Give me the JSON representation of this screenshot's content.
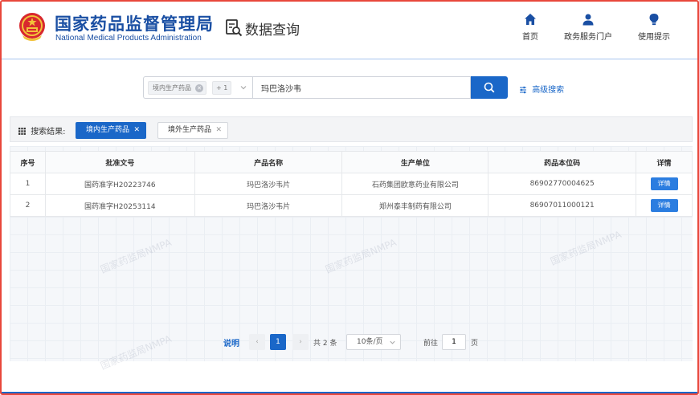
{
  "header": {
    "org_name_cn": "国家药品监督管理局",
    "org_name_en": "National Medical Products Administration",
    "page_title": "数据查询",
    "nav": [
      {
        "label": "首页",
        "icon": "home-icon"
      },
      {
        "label": "政务服务门户",
        "icon": "user-icon"
      },
      {
        "label": "使用提示",
        "icon": "bulb-icon"
      }
    ]
  },
  "search": {
    "category_tag": "境内生产药品",
    "more_count": "+ 1",
    "value": "玛巴洛沙韦",
    "advanced_label": "高级搜索"
  },
  "results": {
    "label": "搜索结果:",
    "tabs": [
      {
        "label": "境内生产药品",
        "active": true
      },
      {
        "label": "境外生产药品",
        "active": false
      }
    ]
  },
  "table": {
    "columns": [
      "序号",
      "批准文号",
      "产品名称",
      "生产单位",
      "药品本位码",
      "详情"
    ],
    "rows": [
      {
        "index": "1",
        "approval_no": "国药准字H20223746",
        "product": "玛巴洛沙韦片",
        "manufacturer": "石药集团欧意药业有限公司",
        "code": "86902770004625",
        "detail": "详情"
      },
      {
        "index": "2",
        "approval_no": "国药准字H20253114",
        "product": "玛巴洛沙韦片",
        "manufacturer": "郑州泰丰制药有限公司",
        "code": "86907011000121",
        "detail": "详情"
      }
    ]
  },
  "watermark": "国家药监局NMPA",
  "pagination": {
    "note": "说明",
    "current_page": "1",
    "total": "共 2 条",
    "page_size": "10条/页",
    "goto_label": "前往",
    "goto_value": "1",
    "page_suffix": "页"
  },
  "colors": {
    "brand_blue": "#1a4fa3",
    "accent_blue": "#1a67c8",
    "frame_red": "#e8473b"
  }
}
